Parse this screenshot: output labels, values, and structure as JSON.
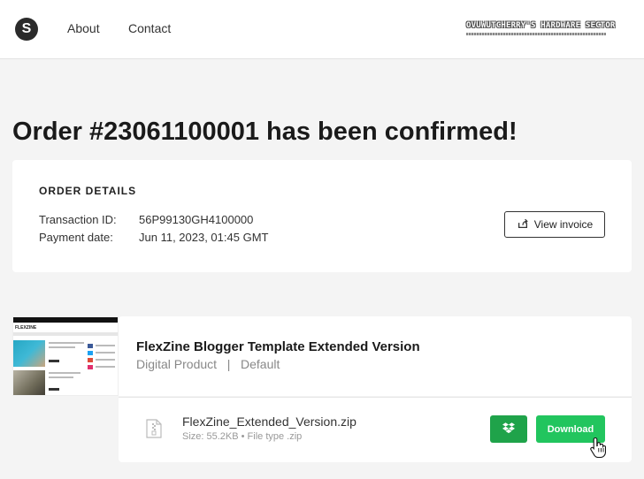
{
  "header": {
    "logo_letter": "S",
    "nav": [
      {
        "label": "About"
      },
      {
        "label": "Contact"
      }
    ],
    "watermark_text": "OVUWUTCHERRY'S HARDWARE SECTOR"
  },
  "page": {
    "title": "Order #23061100001 has been confirmed!"
  },
  "order_details": {
    "heading": "ORDER DETAILS",
    "transaction_label": "Transaction ID:",
    "transaction_value": "56P99130GH4100000",
    "payment_label": "Payment date:",
    "payment_value": "Jun 11, 2023, 01:45 GMT",
    "invoice_button": "View invoice"
  },
  "product": {
    "title": "FlexZine Blogger Template Extended Version",
    "subtitle": "Digital Product   |   Default",
    "thumb_brand": "FLEXZINE"
  },
  "file": {
    "name": "FlexZine_Extended_Version.zip",
    "meta": "Size: 55.2KB • File type .zip",
    "download_label": "Download"
  },
  "colors": {
    "accent_green": "#22c55e",
    "dropbox_green": "#1fa34a",
    "background": "#f4f4f4"
  },
  "icons": {
    "share": "share-icon",
    "dropbox": "dropbox-icon",
    "file": "zip-file-icon",
    "cursor": "hand-cursor-icon"
  }
}
